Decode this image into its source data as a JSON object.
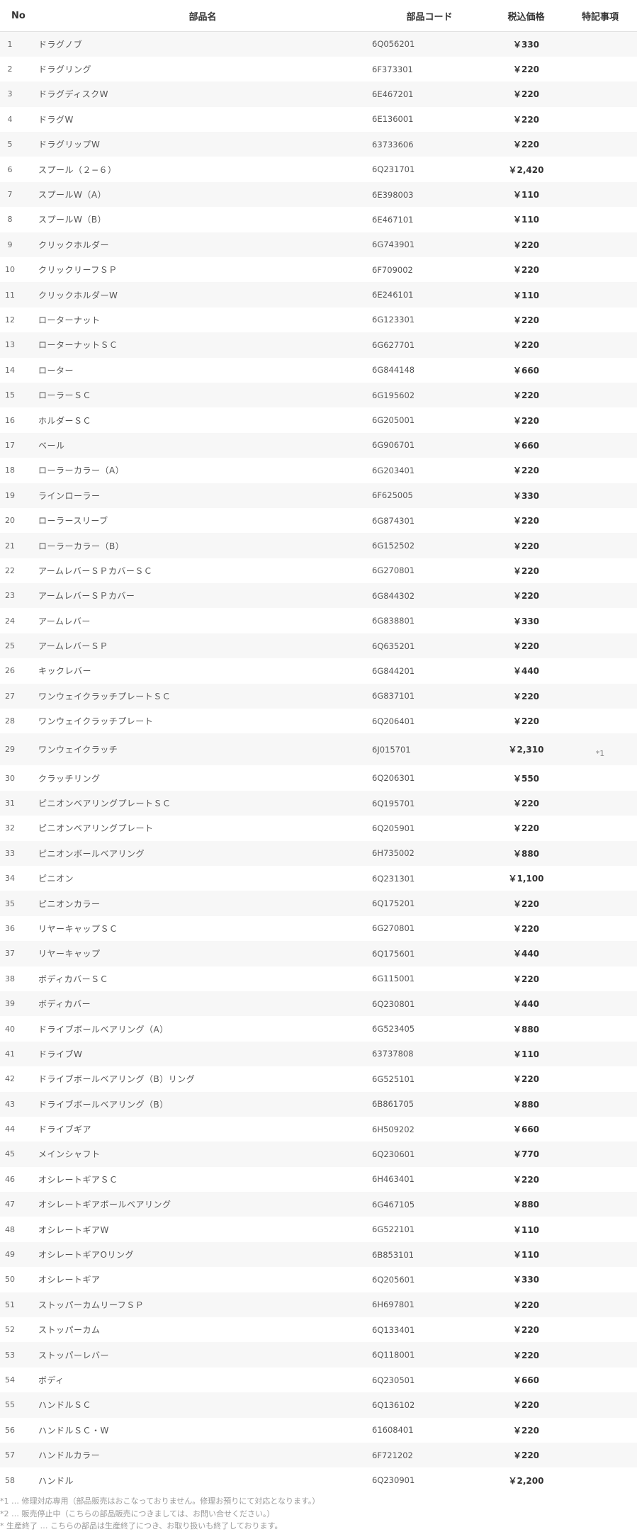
{
  "headers": {
    "no": "No",
    "name": "部品名",
    "code": "部品コード",
    "price": "税込価格",
    "note": "特記事項"
  },
  "rows": [
    {
      "no": "1",
      "name": "ドラグノブ",
      "code": "6Q056201",
      "price": "￥330",
      "note": ""
    },
    {
      "no": "2",
      "name": "ドラグリング",
      "code": "6F373301",
      "price": "￥220",
      "note": ""
    },
    {
      "no": "3",
      "name": "ドラグディスクW",
      "code": "6E467201",
      "price": "￥220",
      "note": ""
    },
    {
      "no": "4",
      "name": "ドラグW",
      "code": "6E136001",
      "price": "￥220",
      "note": ""
    },
    {
      "no": "5",
      "name": "ドラグリップW",
      "code": "63733606",
      "price": "￥220",
      "note": ""
    },
    {
      "no": "6",
      "name": "スプール（２−６）",
      "code": "6Q231701",
      "price": "￥2,420",
      "note": ""
    },
    {
      "no": "7",
      "name": "スプールW（A）",
      "code": "6E398003",
      "price": "￥110",
      "note": ""
    },
    {
      "no": "8",
      "name": "スプールW（B）",
      "code": "6E467101",
      "price": "￥110",
      "note": ""
    },
    {
      "no": "9",
      "name": "クリックホルダー",
      "code": "6G743901",
      "price": "￥220",
      "note": ""
    },
    {
      "no": "10",
      "name": "クリックリーフＳＰ",
      "code": "6F709002",
      "price": "￥220",
      "note": ""
    },
    {
      "no": "11",
      "name": "クリックホルダーW",
      "code": "6E246101",
      "price": "￥110",
      "note": ""
    },
    {
      "no": "12",
      "name": "ローターナット",
      "code": "6G123301",
      "price": "￥220",
      "note": ""
    },
    {
      "no": "13",
      "name": "ローターナットＳＣ",
      "code": "6G627701",
      "price": "￥220",
      "note": ""
    },
    {
      "no": "14",
      "name": "ローター",
      "code": "6G844148",
      "price": "￥660",
      "note": ""
    },
    {
      "no": "15",
      "name": "ローラーＳＣ",
      "code": "6G195602",
      "price": "￥220",
      "note": ""
    },
    {
      "no": "16",
      "name": "ホルダーＳＣ",
      "code": "6G205001",
      "price": "￥220",
      "note": ""
    },
    {
      "no": "17",
      "name": "ベール",
      "code": "6G906701",
      "price": "￥660",
      "note": ""
    },
    {
      "no": "18",
      "name": "ローラーカラー（A）",
      "code": "6G203401",
      "price": "￥220",
      "note": ""
    },
    {
      "no": "19",
      "name": "ラインローラー",
      "code": "6F625005",
      "price": "￥330",
      "note": ""
    },
    {
      "no": "20",
      "name": "ローラースリーブ",
      "code": "6G874301",
      "price": "￥220",
      "note": ""
    },
    {
      "no": "21",
      "name": "ローラーカラー（B）",
      "code": "6G152502",
      "price": "￥220",
      "note": ""
    },
    {
      "no": "22",
      "name": "アームレバーＳＰカバーＳＣ",
      "code": "6G270801",
      "price": "￥220",
      "note": ""
    },
    {
      "no": "23",
      "name": "アームレバーＳＰカバー",
      "code": "6G844302",
      "price": "￥220",
      "note": ""
    },
    {
      "no": "24",
      "name": "アームレバー",
      "code": "6G838801",
      "price": "￥330",
      "note": ""
    },
    {
      "no": "25",
      "name": "アームレバーＳＰ",
      "code": "6Q635201",
      "price": "￥220",
      "note": ""
    },
    {
      "no": "26",
      "name": "キックレバー",
      "code": "6G844201",
      "price": "￥440",
      "note": ""
    },
    {
      "no": "27",
      "name": "ワンウェイクラッチプレートＳＣ",
      "code": "6G837101",
      "price": "￥220",
      "note": ""
    },
    {
      "no": "28",
      "name": "ワンウェイクラッチプレート",
      "code": "6Q206401",
      "price": "￥220",
      "note": ""
    },
    {
      "no": "29",
      "name": "ワンウェイクラッチ",
      "code": "6J015701",
      "price": "￥2,310",
      "note": "*1"
    },
    {
      "no": "30",
      "name": "クラッチリング",
      "code": "6Q206301",
      "price": "￥550",
      "note": ""
    },
    {
      "no": "31",
      "name": "ピニオンベアリングプレートＳＣ",
      "code": "6Q195701",
      "price": "￥220",
      "note": ""
    },
    {
      "no": "32",
      "name": "ピニオンベアリングプレート",
      "code": "6Q205901",
      "price": "￥220",
      "note": ""
    },
    {
      "no": "33",
      "name": "ピニオンボールベアリング",
      "code": "6H735002",
      "price": "￥880",
      "note": ""
    },
    {
      "no": "34",
      "name": "ピニオン",
      "code": "6Q231301",
      "price": "￥1,100",
      "note": ""
    },
    {
      "no": "35",
      "name": "ピニオンカラー",
      "code": "6Q175201",
      "price": "￥220",
      "note": ""
    },
    {
      "no": "36",
      "name": "リヤーキャップＳＣ",
      "code": "6G270801",
      "price": "￥220",
      "note": ""
    },
    {
      "no": "37",
      "name": "リヤーキャップ",
      "code": "6Q175601",
      "price": "￥440",
      "note": ""
    },
    {
      "no": "38",
      "name": "ボディカバーＳＣ",
      "code": "6G115001",
      "price": "￥220",
      "note": ""
    },
    {
      "no": "39",
      "name": "ボディカバー",
      "code": "6Q230801",
      "price": "￥440",
      "note": ""
    },
    {
      "no": "40",
      "name": "ドライブボールベアリング（A）",
      "code": "6G523405",
      "price": "￥880",
      "note": ""
    },
    {
      "no": "41",
      "name": "ドライブW",
      "code": "63737808",
      "price": "￥110",
      "note": ""
    },
    {
      "no": "42",
      "name": "ドライブボールベアリング（B）リング",
      "code": "6G525101",
      "price": "￥220",
      "note": ""
    },
    {
      "no": "43",
      "name": "ドライブボールベアリング（B）",
      "code": "6B861705",
      "price": "￥880",
      "note": ""
    },
    {
      "no": "44",
      "name": "ドライブギア",
      "code": "6H509202",
      "price": "￥660",
      "note": ""
    },
    {
      "no": "45",
      "name": "メインシャフト",
      "code": "6Q230601",
      "price": "￥770",
      "note": ""
    },
    {
      "no": "46",
      "name": "オシレートギアＳＣ",
      "code": "6H463401",
      "price": "￥220",
      "note": ""
    },
    {
      "no": "47",
      "name": "オシレートギアボールベアリング",
      "code": "6G467105",
      "price": "￥880",
      "note": ""
    },
    {
      "no": "48",
      "name": "オシレートギアW",
      "code": "6G522101",
      "price": "￥110",
      "note": ""
    },
    {
      "no": "49",
      "name": "オシレートギアOリング",
      "code": "6B853101",
      "price": "￥110",
      "note": ""
    },
    {
      "no": "50",
      "name": "オシレートギア",
      "code": "6Q205601",
      "price": "￥330",
      "note": ""
    },
    {
      "no": "51",
      "name": "ストッパーカムリーフＳＰ",
      "code": "6H697801",
      "price": "￥220",
      "note": ""
    },
    {
      "no": "52",
      "name": "ストッパーカム",
      "code": "6Q133401",
      "price": "￥220",
      "note": ""
    },
    {
      "no": "53",
      "name": "ストッパーレバー",
      "code": "6Q118001",
      "price": "￥220",
      "note": ""
    },
    {
      "no": "54",
      "name": "ボディ",
      "code": "6Q230501",
      "price": "￥660",
      "note": ""
    },
    {
      "no": "55",
      "name": "ハンドルＳＣ",
      "code": "6Q136102",
      "price": "￥220",
      "note": ""
    },
    {
      "no": "56",
      "name": "ハンドルＳＣ・W",
      "code": "61608401",
      "price": "￥220",
      "note": ""
    },
    {
      "no": "57",
      "name": "ハンドルカラー",
      "code": "6F721202",
      "price": "￥220",
      "note": ""
    },
    {
      "no": "58",
      "name": "ハンドル",
      "code": "6Q230901",
      "price": "￥2,200",
      "note": ""
    }
  ],
  "footnotes": [
    "*1 … 修理対応専用（部品販売はおこなっておりません。修理お預りにて対応となります。）",
    "*2 … 販売停止中（こちらの部品販売につきましては、お問い合せください。）",
    "* 生産終了 … こちらの部品は生産終了につき、お取り扱いも終了しております。"
  ]
}
